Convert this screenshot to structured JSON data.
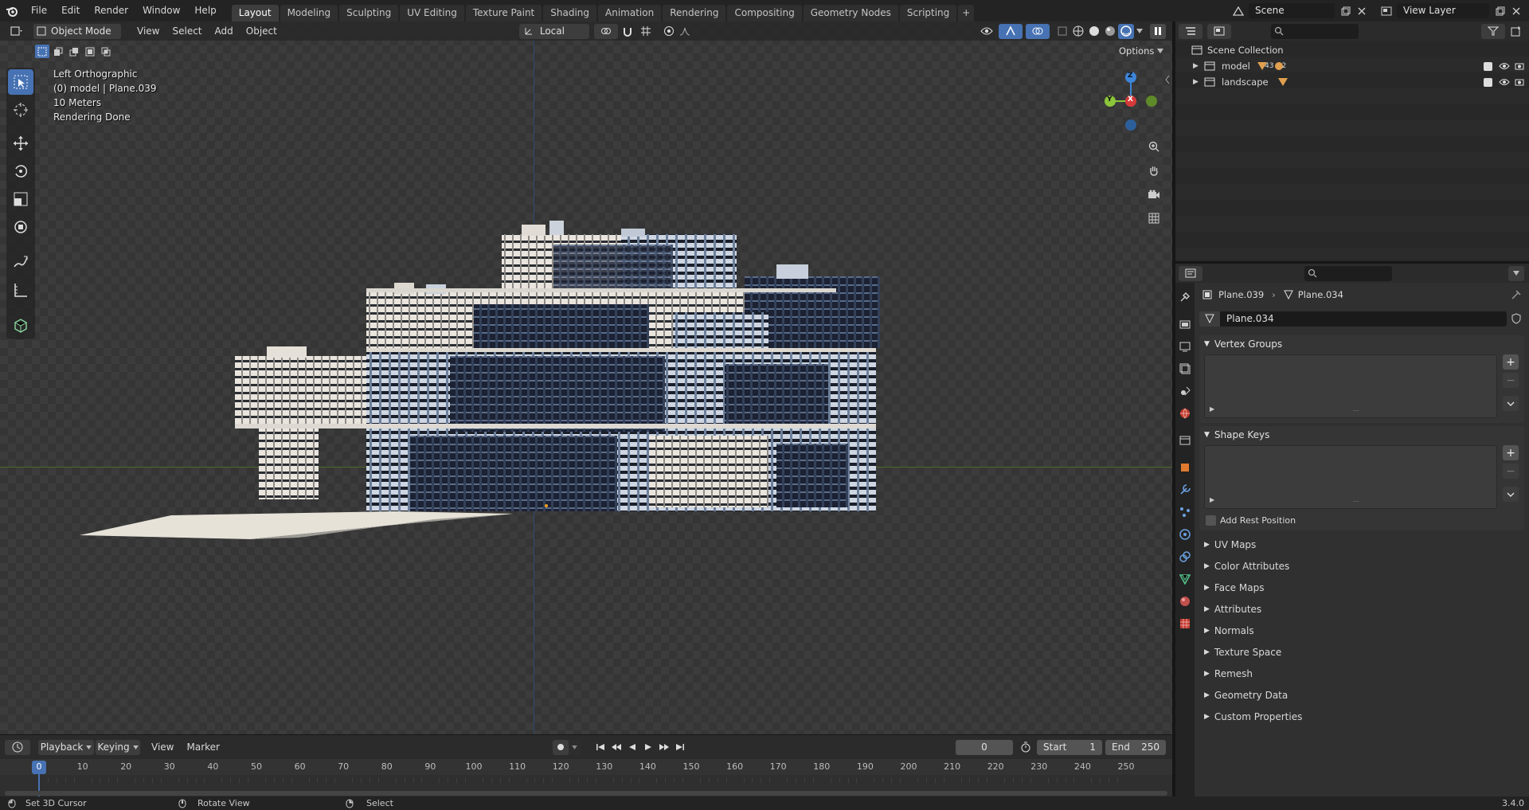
{
  "menu": [
    "File",
    "Edit",
    "Render",
    "Window",
    "Help"
  ],
  "workspaces": [
    "Layout",
    "Modeling",
    "Sculpting",
    "UV Editing",
    "Texture Paint",
    "Shading",
    "Animation",
    "Rendering",
    "Compositing",
    "Geometry Nodes",
    "Scripting"
  ],
  "active_workspace": "Layout",
  "scene_name": "Scene",
  "view_layer": "View Layer",
  "viewport": {
    "mode": "Object Mode",
    "menus": [
      "View",
      "Select",
      "Add",
      "Object"
    ],
    "transform_orientation": "Local",
    "options_label": "Options",
    "info_lines": [
      "Left Orthographic",
      "(0) model | Plane.039",
      "10 Meters",
      "Rendering Done"
    ],
    "gizmo_axes": {
      "z": "Z",
      "y": "Y",
      "x": "X"
    }
  },
  "timeline": {
    "menus": [
      "Playback",
      "Keying",
      "View",
      "Marker"
    ],
    "current_frame": "0",
    "start_label": "Start",
    "start": "1",
    "end_label": "End",
    "end": "250",
    "ticks": [
      "0",
      "10",
      "20",
      "30",
      "40",
      "50",
      "60",
      "70",
      "80",
      "90",
      "100",
      "110",
      "120",
      "130",
      "140",
      "150",
      "160",
      "170",
      "180",
      "190",
      "200",
      "210",
      "220",
      "230",
      "240",
      "250"
    ]
  },
  "status": {
    "left_hint": "Set 3D Cursor",
    "middle_hint": "Rotate View",
    "right_hint": "Select",
    "version": "3.4.0"
  },
  "outliner": {
    "root": "Scene Collection",
    "collections": [
      {
        "name": "model",
        "badge1": "43",
        "badge2": "2"
      },
      {
        "name": "landscape",
        "badge1": "",
        "badge2": ""
      }
    ]
  },
  "properties": {
    "breadcrumb_object": "Plane.039",
    "breadcrumb_data": "Plane.034",
    "mesh_name": "Plane.034",
    "vertex_groups": "Vertex Groups",
    "shape_keys": "Shape Keys",
    "add_rest_position": "Add Rest Position",
    "collapsed_panels": [
      "UV Maps",
      "Color Attributes",
      "Face Maps",
      "Attributes",
      "Normals",
      "Texture Space",
      "Remesh",
      "Geometry Data",
      "Custom Properties"
    ]
  },
  "colors": {
    "accent": "#4772b3",
    "x_axis": "#d63a3a",
    "y_axis": "#8bc53a",
    "z_axis": "#3d85d8",
    "mesh_tab": "#52c28a"
  }
}
